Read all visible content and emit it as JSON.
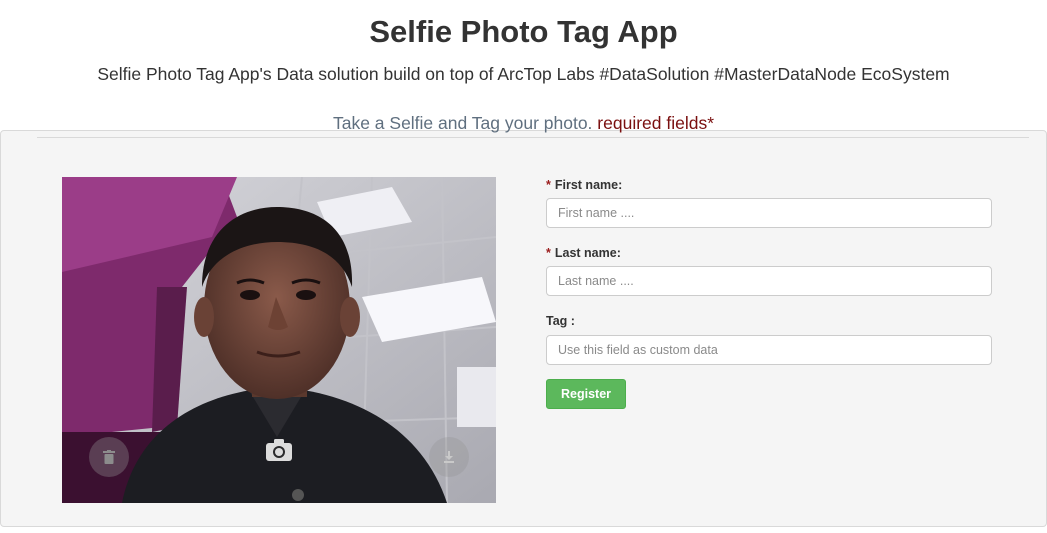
{
  "header": {
    "title": "Selfie Photo Tag App",
    "subtitle": "Selfie Photo Tag App's Data solution build on top of ArcTop Labs #DataSolution #MasterDataNode EcoSystem"
  },
  "panel": {
    "caption": "Take a Selfie and Tag your photo.",
    "required_note": "required fields*"
  },
  "camera": {
    "controls": [
      {
        "name": "trash-icon"
      },
      {
        "name": "camera-icon"
      },
      {
        "name": "download-icon"
      }
    ]
  },
  "form": {
    "first_name": {
      "required_marker": "*",
      "label": "First name:",
      "value": "",
      "placeholder": "First name ...."
    },
    "last_name": {
      "required_marker": "*",
      "label": "Last name:",
      "value": "",
      "placeholder": "Last name ...."
    },
    "tag": {
      "label": "Tag :",
      "value": "",
      "placeholder": "Use this field as custom data"
    },
    "register_label": "Register"
  },
  "colors": {
    "panel_background": "#f5f5f5",
    "caption_text": "#5f6f7f",
    "required_text": "#7a0f0f",
    "register_button": "#5cb85c"
  }
}
